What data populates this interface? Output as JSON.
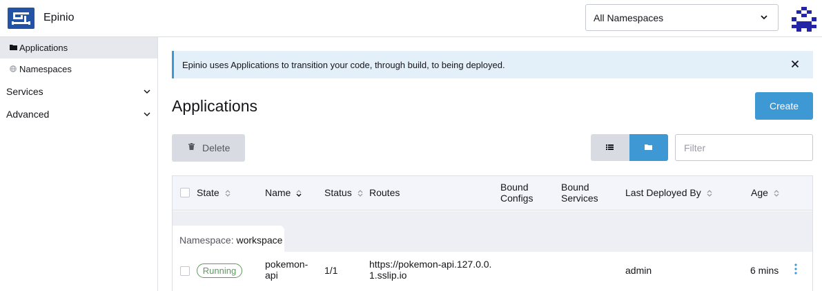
{
  "header": {
    "app_name": "Epinio",
    "namespace_select": "All Namespaces"
  },
  "sidebar": {
    "items": [
      {
        "label": "Applications",
        "icon": "folder-icon",
        "active": true
      },
      {
        "label": "Namespaces",
        "icon": "globe-icon",
        "active": false
      }
    ],
    "groups": [
      {
        "label": "Services"
      },
      {
        "label": "Advanced"
      }
    ]
  },
  "banner": {
    "text": "Epinio uses Applications to transition your code, through build, to being deployed."
  },
  "main": {
    "title": "Applications",
    "create_label": "Create",
    "delete_label": "Delete",
    "filter_placeholder": "Filter"
  },
  "table": {
    "headers": {
      "state": "State",
      "name": "Name",
      "status": "Status",
      "routes": "Routes",
      "bound_configs_1": "Bound",
      "bound_configs_2": "Configs",
      "bound_services_1": "Bound",
      "bound_services_2": "Services",
      "last_deployed_by": "Last Deployed By",
      "age": "Age"
    },
    "group": {
      "label": "Namespace:",
      "value": "workspace"
    },
    "rows": [
      {
        "state": "Running",
        "name_1": "pokemon-",
        "name_2": "api",
        "status": "1/1",
        "route_1": "https://pokemon-api.127.0.0.",
        "route_2": "1.sslip.io",
        "last_deployed_by": "admin",
        "age": "6 mins"
      }
    ]
  },
  "colors": {
    "accent": "#3d98d3",
    "brand": "#2453a6",
    "running": "#5d995d"
  }
}
